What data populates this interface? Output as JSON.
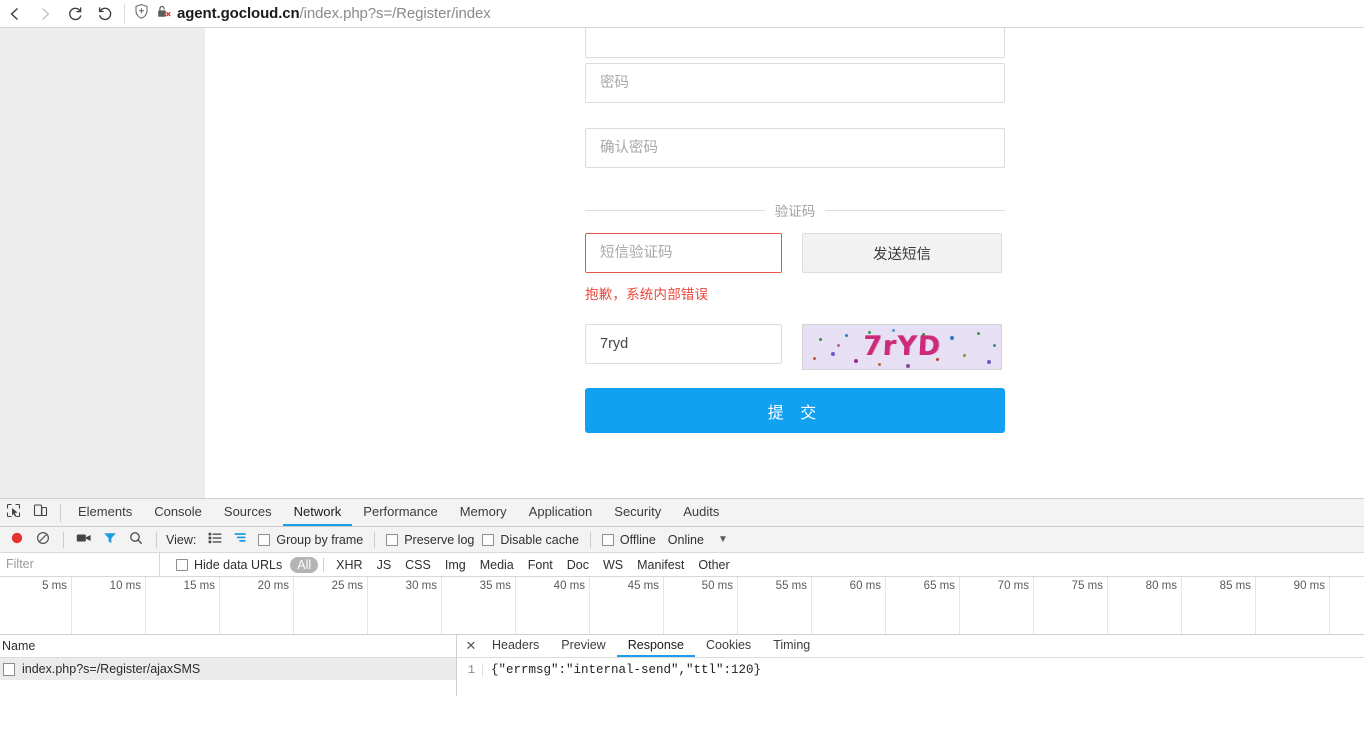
{
  "browser": {
    "back_icon": "back-arrow-icon",
    "forward_icon": "forward-arrow-icon",
    "reload_icon": "reload-icon",
    "history_icon": "undo-history-icon",
    "shield_icon": "shield-plus-icon",
    "insecure_icon": "broken-lock-icon",
    "url_host": "agent.gocloud.cn",
    "url_path": "/index.php?s=/Register/index"
  },
  "page": {
    "fields": {
      "password_placeholder": "密码",
      "password_confirm_placeholder": "确认密码",
      "sms_code_placeholder": "短信验证码",
      "captcha_value": "7ryd"
    },
    "vcode_divider_label": "验证码",
    "send_sms_label": "发送短信",
    "error_text": "抱歉，系统内部错误",
    "captcha_image_text": "7rYD",
    "submit_label": "提 交",
    "accent_color": "#12a0f0",
    "error_color": "#e8473a"
  },
  "devtools": {
    "inspect_icon": "inspect-element-icon",
    "device_icon": "device-toolbar-icon",
    "tabs": [
      {
        "label": "Elements",
        "active": false
      },
      {
        "label": "Console",
        "active": false
      },
      {
        "label": "Sources",
        "active": false
      },
      {
        "label": "Network",
        "active": true
      },
      {
        "label": "Performance",
        "active": false
      },
      {
        "label": "Memory",
        "active": false
      },
      {
        "label": "Application",
        "active": false
      },
      {
        "label": "Security",
        "active": false
      },
      {
        "label": "Audits",
        "active": false
      }
    ],
    "network_toolbar": {
      "record_icon": "record-stop-icon",
      "clear_icon": "clear-icon",
      "camera_icon": "filmstrip-camera-icon",
      "filter_icon": "filter-funnel-icon",
      "search_icon": "search-icon",
      "view_label": "View:",
      "list_view_icon": "list-view-icon",
      "waterfall_icon": "waterfall-view-icon",
      "group_by_frame_label": "Group by frame",
      "preserve_log_label": "Preserve log",
      "disable_cache_label": "Disable cache",
      "offline_label": "Offline",
      "throttle_value": "Online",
      "more_icon": "chevron-down-icon"
    },
    "filter_bar": {
      "filter_placeholder": "Filter",
      "hide_data_urls_label": "Hide data URLs",
      "types": [
        "All",
        "XHR",
        "JS",
        "CSS",
        "Img",
        "Media",
        "Font",
        "Doc",
        "WS",
        "Manifest",
        "Other"
      ],
      "active_type": "All"
    },
    "timeline_ticks": [
      "5 ms",
      "10 ms",
      "15 ms",
      "20 ms",
      "25 ms",
      "30 ms",
      "35 ms",
      "40 ms",
      "45 ms",
      "50 ms",
      "55 ms",
      "60 ms",
      "65 ms",
      "70 ms",
      "75 ms",
      "80 ms",
      "85 ms",
      "90 ms"
    ],
    "request_list": {
      "column_header": "Name",
      "rows": [
        {
          "name": "index.php?s=/Register/ajaxSMS",
          "selected": true
        }
      ]
    },
    "detail_panel": {
      "close_icon": "close-icon",
      "tabs": [
        {
          "label": "Headers",
          "active": false
        },
        {
          "label": "Preview",
          "active": false
        },
        {
          "label": "Response",
          "active": true
        },
        {
          "label": "Cookies",
          "active": false
        },
        {
          "label": "Timing",
          "active": false
        }
      ],
      "response_line_number": "1",
      "response_body": "{\"errmsg\":\"internal-send\",\"ttl\":120}"
    }
  }
}
